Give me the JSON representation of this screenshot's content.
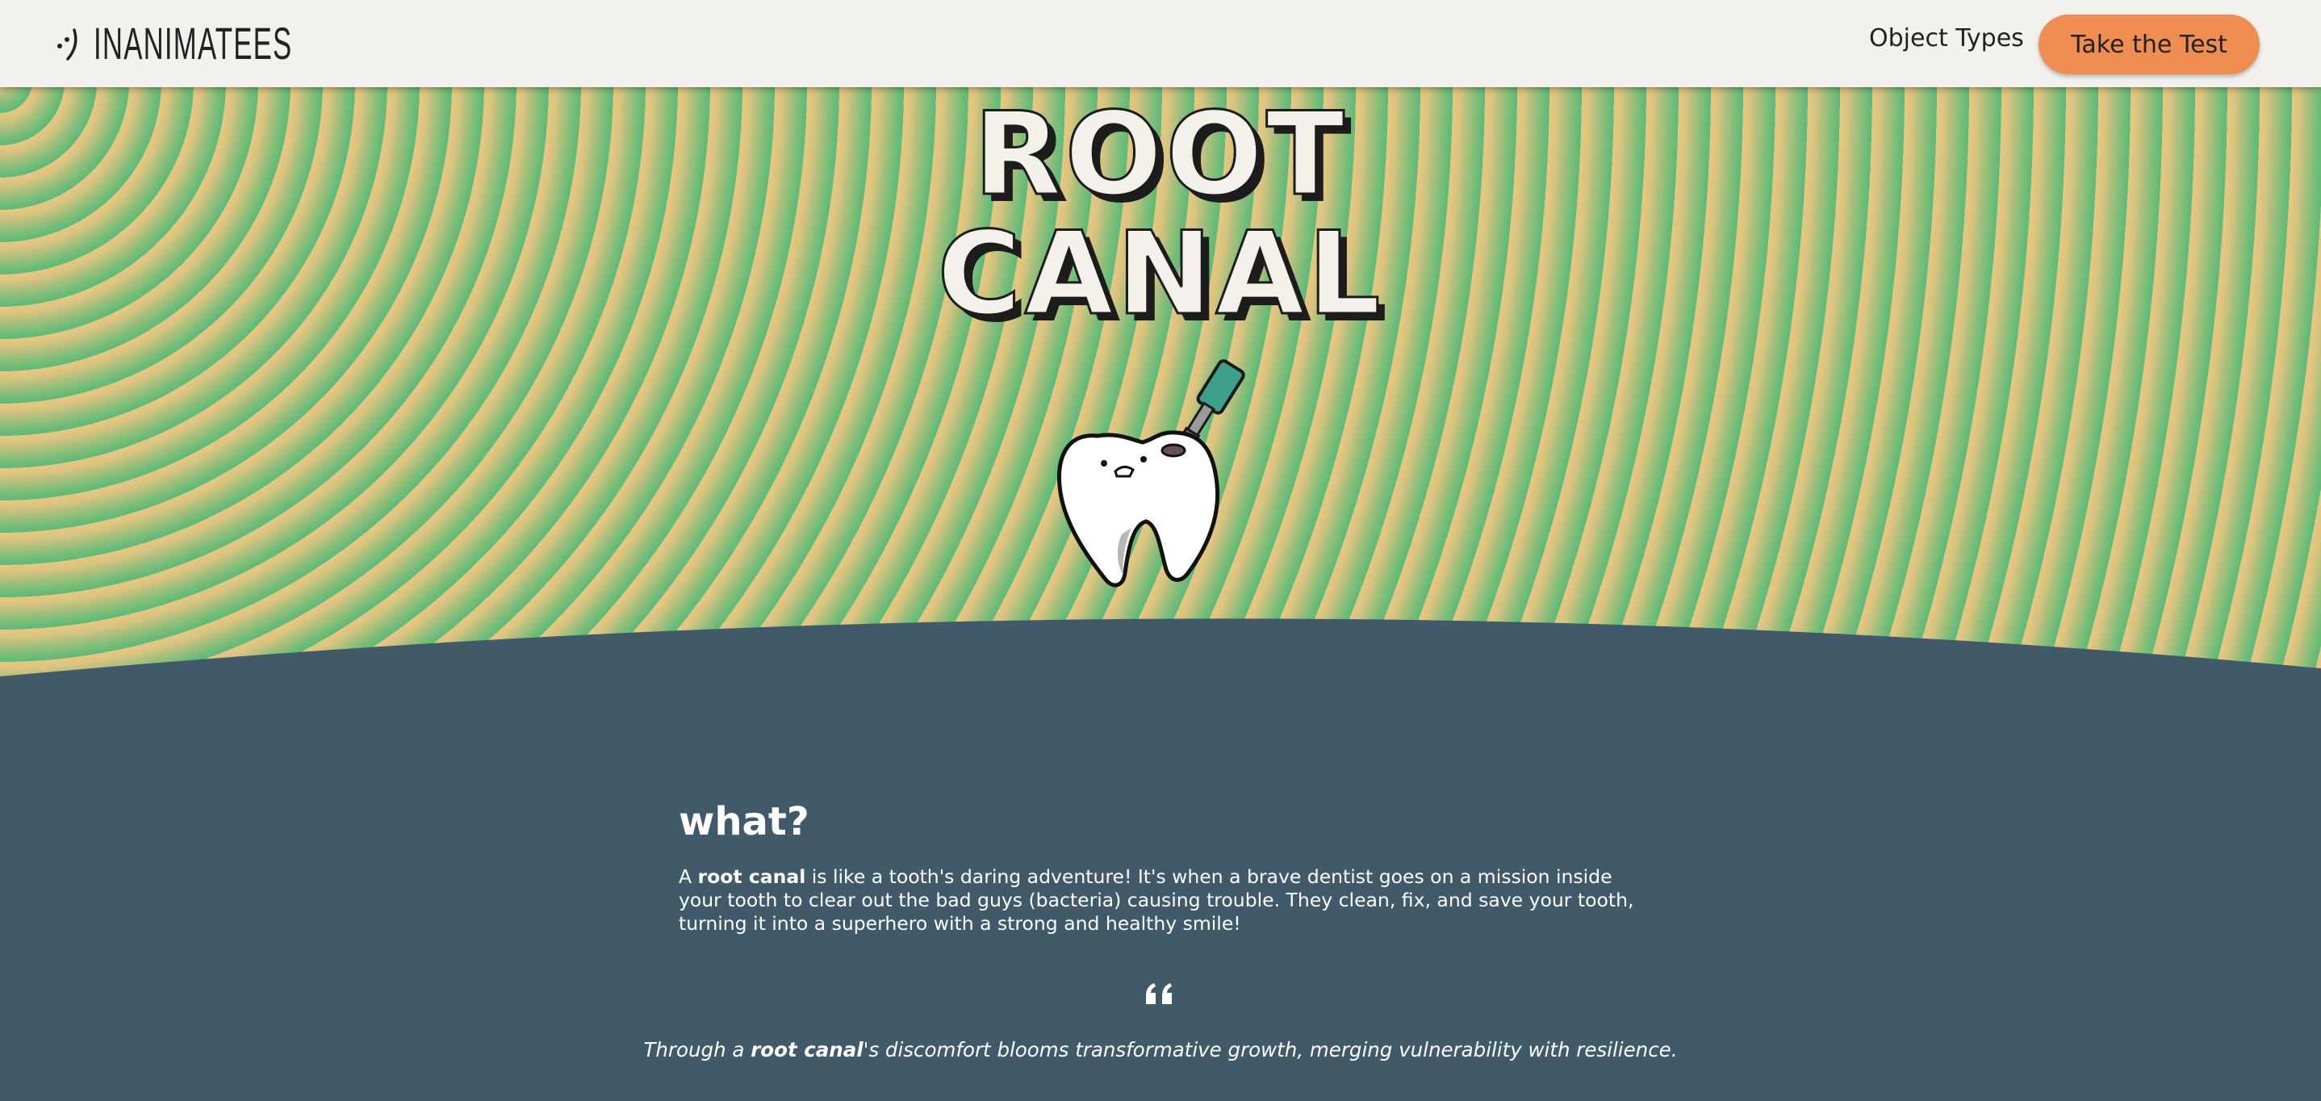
{
  "header": {
    "brand": "INANIMATEES",
    "nav_object_types": "Object Types",
    "cta_label": "Take the Test"
  },
  "hero": {
    "title_line1": "ROOT",
    "title_line2": "CANAL",
    "illustration": "tooth-with-drill"
  },
  "section": {
    "heading": "what?",
    "text_prefix": "A ",
    "text_bold": "root canal",
    "text_rest": " is like a tooth's daring adventure! It's when a brave dentist goes on a mission inside your tooth to clear out the bad guys (bacteria) causing trouble. They clean, fix, and save your tooth, turning it into a superhero with a strong and healthy smile!"
  },
  "quote": {
    "icon": "quote-icon",
    "prefix": "Through a ",
    "bold": "root canal",
    "rest": "'s discomfort blooms transformative growth, merging vulnerability with resilience."
  },
  "colors": {
    "header_bg": "#f3f1ed",
    "cta_bg": "#ef8e50",
    "content_bg": "#415a69",
    "hero_green": "#5fb87a",
    "hero_yellow": "#e8c77f"
  }
}
